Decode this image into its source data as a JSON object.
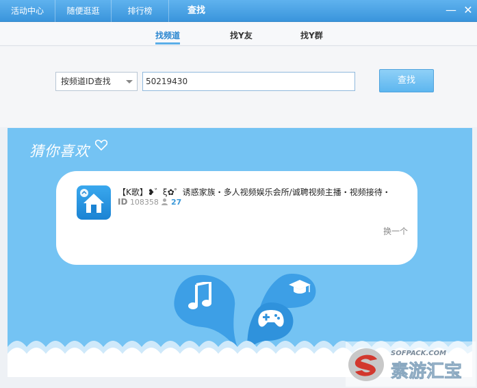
{
  "topbar": {
    "tabs": [
      {
        "label": "活动中心"
      },
      {
        "label": "随便逛逛"
      },
      {
        "label": "排行榜"
      },
      {
        "label": "查找"
      }
    ],
    "minimize": "—",
    "close": "✕"
  },
  "subtabs": [
    {
      "label": "找频道"
    },
    {
      "label": "找Y友"
    },
    {
      "label": "找Y群"
    }
  ],
  "search": {
    "select_value": "按频道ID查找",
    "input_value": "50219430",
    "button_label": "查找"
  },
  "recommend": {
    "heading": "猜你喜欢",
    "card": {
      "title": "【K歌】❥゛ξ✿゜诱惑家族・多人视频娱乐会所/诚聘视频主播・视频接待・",
      "id_label": "ID",
      "id_value": "108358",
      "member_count": "27"
    },
    "change_label": "换一个"
  },
  "watermark": {
    "url": "SOFPACK.COM",
    "text": "素游汇宝"
  },
  "colors": {
    "topbar": "#4aa3e6",
    "accent": "#2a86d0",
    "panel": "#74c3f3"
  }
}
